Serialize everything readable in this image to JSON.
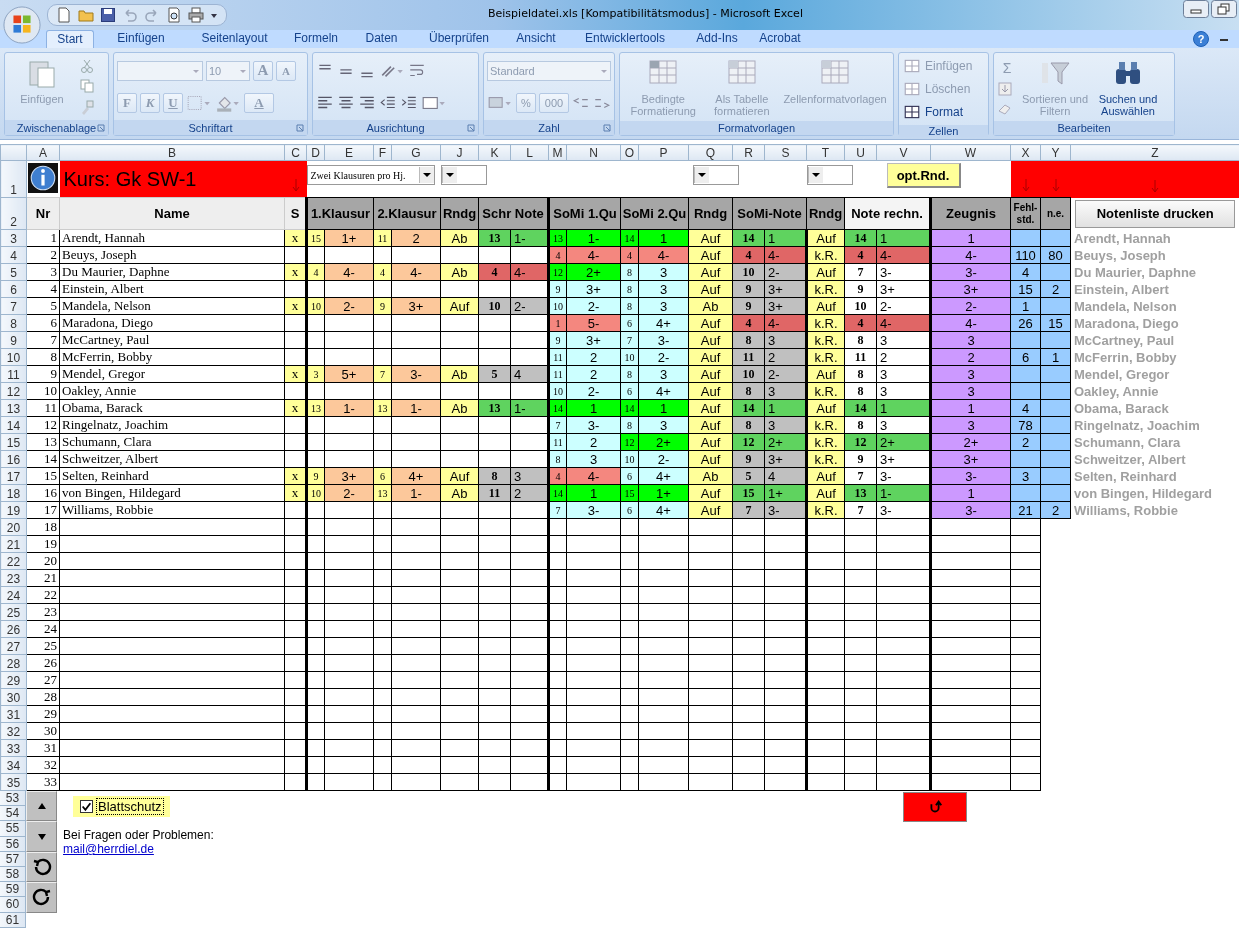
{
  "window": {
    "title": "Beispieldatei.xls  [Kompatibilitätsmodus] - Microsoft Excel"
  },
  "ribbon": {
    "tabs": [
      {
        "label": "Start",
        "selected": true
      },
      {
        "label": "Einfügen",
        "selected": false
      },
      {
        "label": "Seitenlayout",
        "selected": false
      },
      {
        "label": "Formeln",
        "selected": false
      },
      {
        "label": "Daten",
        "selected": false
      },
      {
        "label": "Überprüfen",
        "selected": false
      },
      {
        "label": "Ansicht",
        "selected": false
      },
      {
        "label": "Entwicklertools",
        "selected": false
      },
      {
        "label": "Add-Ins",
        "selected": false
      },
      {
        "label": "Acrobat",
        "selected": false
      }
    ],
    "help": "?",
    "groups": [
      {
        "label": "Zwischenablage",
        "buttons": [
          {
            "label": "Einfügen",
            "disabled": true
          }
        ]
      },
      {
        "label": "Schriftart",
        "font_size": "10",
        "buttons": [
          {
            "label": "A",
            "disabled": true
          },
          {
            "label": "A",
            "disabled": true
          },
          {
            "label": "F",
            "disabled": true
          },
          {
            "label": "K",
            "disabled": true
          },
          {
            "label": "U",
            "disabled": true
          },
          {
            "label": "A",
            "disabled": true
          }
        ]
      },
      {
        "label": "Ausrichtung"
      },
      {
        "label": "Zahl",
        "format": "Standard",
        "buttons": [
          {
            "label": "%",
            "disabled": true
          },
          {
            "label": "000",
            "disabled": true
          }
        ]
      },
      {
        "label": "Formatvorlagen",
        "buttons": [
          {
            "label": "Bedingte Formatierung",
            "disabled": true
          },
          {
            "label": "Als Tabelle formatieren",
            "disabled": true
          },
          {
            "label": "Zellenformatvorlagen",
            "disabled": true
          }
        ]
      },
      {
        "label": "Zellen",
        "buttons": [
          {
            "label": "Einfügen",
            "disabled": true
          },
          {
            "label": "Löschen",
            "disabled": true
          },
          {
            "label": "Format",
            "disabled": false
          }
        ]
      },
      {
        "label": "Bearbeiten",
        "buttons": [
          {
            "label": "Σ",
            "disabled": true
          },
          {
            "label": "Sortieren und Filtern",
            "disabled": true
          },
          {
            "label": "Suchen und Auswählen",
            "disabled": false
          }
        ]
      }
    ]
  },
  "sheet": {
    "columns": [
      "A",
      "B",
      "C",
      "D",
      "E",
      "F",
      "G",
      "J",
      "K",
      "L",
      "M",
      "N",
      "O",
      "P",
      "Q",
      "R",
      "S",
      "T",
      "U",
      "V",
      "W",
      "X",
      "Y",
      "Z"
    ],
    "course": "Kurs:  Gk SW-1",
    "mode": "Zwei Klausuren pro Hj.",
    "opt_button": "opt.Rnd.",
    "headers": [
      "Nr",
      "Name",
      "S",
      "1.Klausur",
      "2.Klausur",
      "Rndg",
      "Schr Note",
      "SoMi 1.Qu",
      "SoMi 2.Qu",
      "Rndg",
      "SoMi-Note",
      "Rndg",
      "Note rechn.",
      "Zeugnis",
      "Fehl-std.",
      "n.e."
    ],
    "print_button": "Notenliste drucken",
    "students": [
      {
        "row": "3",
        "nr": "1",
        "name": "Arendt, Hannah",
        "s": "x",
        "k1": {
          "pts": "15",
          "grade": "1+"
        },
        "k2": {
          "pts": "11",
          "grade": "2"
        },
        "r1": "Ab",
        "schr": {
          "pts": "13",
          "grade": "1-",
          "color": "#5fd35f"
        },
        "so1": {
          "pts": "13",
          "grade": "1-",
          "color": "#00ff00"
        },
        "so2": {
          "pts": "14",
          "grade": "1",
          "color": "#00ff00"
        },
        "r2": "Auf",
        "son": {
          "pts": "14",
          "grade": "1",
          "color": "#5fd35f"
        },
        "r3": "Auf",
        "rech": {
          "pts": "14",
          "grade": "1",
          "color": "#5fd35f"
        },
        "zeugnis": "1",
        "list": "Arendt, Hannah"
      },
      {
        "row": "4",
        "nr": "2",
        "name": "Beuys, Joseph",
        "so1": {
          "pts": "4",
          "grade": "4-",
          "color": "#f4877f"
        },
        "so2": {
          "pts": "4",
          "grade": "4-",
          "color": "#f4877f"
        },
        "r2": "Auf",
        "son": {
          "pts": "4",
          "grade": "4-",
          "color": "#e06666"
        },
        "r3": "k.R.",
        "rech": {
          "pts": "4",
          "grade": "4-",
          "color": "#e06666"
        },
        "zeugnis": "4-",
        "fehl": "110",
        "ne": "80",
        "list": "Beuys, Joseph"
      },
      {
        "row": "5",
        "nr": "3",
        "name": "Du Maurier, Daphne",
        "s": "x",
        "k1": {
          "pts": "4",
          "grade": "4-"
        },
        "k2": {
          "pts": "4",
          "grade": "4-"
        },
        "r1": "Ab",
        "schr": {
          "pts": "4",
          "grade": "4-",
          "color": "#e06666"
        },
        "so1": {
          "pts": "12",
          "grade": "2+",
          "color": "#00ff00"
        },
        "so2": {
          "pts": "8",
          "grade": "3",
          "color": "#ccffff"
        },
        "r2": "Auf",
        "son": {
          "pts": "10",
          "grade": "2-",
          "color": "#c0c0c0"
        },
        "r3": "Auf",
        "rech": {
          "pts": "7",
          "grade": "3-",
          "color": "#ffffff"
        },
        "zeugnis": "3-",
        "fehl": "4",
        "list": "Du Maurier, Daphne"
      },
      {
        "row": "6",
        "nr": "4",
        "name": "Einstein, Albert",
        "so1": {
          "pts": "9",
          "grade": "3+",
          "color": "#ccffff"
        },
        "so2": {
          "pts": "8",
          "grade": "3",
          "color": "#ccffff"
        },
        "r2": "Auf",
        "son": {
          "pts": "9",
          "grade": "3+",
          "color": "#c0c0c0"
        },
        "r3": "k.R.",
        "rech": {
          "pts": "9",
          "grade": "3+",
          "color": "#ffffff"
        },
        "zeugnis": "3+",
        "fehl": "15",
        "ne": "2",
        "list": "Einstein, Albert"
      },
      {
        "row": "7",
        "nr": "5",
        "name": "Mandela, Nelson",
        "s": "x",
        "k1": {
          "pts": "10",
          "grade": "2-"
        },
        "k2": {
          "pts": "9",
          "grade": "3+"
        },
        "r1": "Auf",
        "schr": {
          "pts": "10",
          "grade": "2-",
          "color": "#c0c0c0"
        },
        "so1": {
          "pts": "10",
          "grade": "2-",
          "color": "#ccffff"
        },
        "so2": {
          "pts": "8",
          "grade": "3",
          "color": "#ccffff"
        },
        "r2": "Ab",
        "son": {
          "pts": "9",
          "grade": "3+",
          "color": "#c0c0c0"
        },
        "r3": "Auf",
        "rech": {
          "pts": "10",
          "grade": "2-",
          "color": "#ffffff"
        },
        "zeugnis": "2-",
        "fehl": "1",
        "list": "Mandela, Nelson"
      },
      {
        "row": "8",
        "nr": "6",
        "name": "Maradona, Diego",
        "so1": {
          "pts": "1",
          "grade": "5-",
          "color": "#f4877f"
        },
        "so2": {
          "pts": "6",
          "grade": "4+",
          "color": "#ccffff"
        },
        "r2": "Auf",
        "son": {
          "pts": "4",
          "grade": "4-",
          "color": "#e06666"
        },
        "r3": "k.R.",
        "rech": {
          "pts": "4",
          "grade": "4-",
          "color": "#e06666"
        },
        "zeugnis": "4-",
        "fehl": "26",
        "ne": "15",
        "list": "Maradona, Diego"
      },
      {
        "row": "9",
        "nr": "7",
        "name": "McCartney, Paul",
        "so1": {
          "pts": "9",
          "grade": "3+",
          "color": "#ccffff"
        },
        "so2": {
          "pts": "7",
          "grade": "3-",
          "color": "#ccffff"
        },
        "r2": "Auf",
        "son": {
          "pts": "8",
          "grade": "3",
          "color": "#c0c0c0"
        },
        "r3": "k.R.",
        "rech": {
          "pts": "8",
          "grade": "3",
          "color": "#ffffff"
        },
        "zeugnis": "3",
        "list": "McCartney, Paul"
      },
      {
        "row": "10",
        "nr": "8",
        "name": "McFerrin, Bobby",
        "so1": {
          "pts": "11",
          "grade": "2",
          "color": "#ccffff"
        },
        "so2": {
          "pts": "10",
          "grade": "2-",
          "color": "#ccffff"
        },
        "r2": "Auf",
        "son": {
          "pts": "11",
          "grade": "2",
          "color": "#c0c0c0"
        },
        "r3": "k.R.",
        "rech": {
          "pts": "11",
          "grade": "2",
          "color": "#ffffff"
        },
        "zeugnis": "2",
        "fehl": "6",
        "ne": "1",
        "list": "McFerrin, Bobby"
      },
      {
        "row": "11",
        "nr": "9",
        "name": "Mendel, Gregor",
        "s": "x",
        "k1": {
          "pts": "3",
          "grade": "5+"
        },
        "k2": {
          "pts": "7",
          "grade": "3-"
        },
        "r1": "Ab",
        "schr": {
          "pts": "5",
          "grade": "4",
          "color": "#c0c0c0"
        },
        "so1": {
          "pts": "11",
          "grade": "2",
          "color": "#ccffff"
        },
        "so2": {
          "pts": "8",
          "grade": "3",
          "color": "#ccffff"
        },
        "r2": "Auf",
        "son": {
          "pts": "10",
          "grade": "2-",
          "color": "#c0c0c0"
        },
        "r3": "Auf",
        "rech": {
          "pts": "8",
          "grade": "3",
          "color": "#ffffff"
        },
        "zeugnis": "3",
        "list": "Mendel, Gregor"
      },
      {
        "row": "12",
        "nr": "10",
        "name": "Oakley, Annie",
        "so1": {
          "pts": "10",
          "grade": "2-",
          "color": "#ccffff"
        },
        "so2": {
          "pts": "6",
          "grade": "4+",
          "color": "#ccffff"
        },
        "r2": "Auf",
        "son": {
          "pts": "8",
          "grade": "3",
          "color": "#c0c0c0"
        },
        "r3": "k.R.",
        "rech": {
          "pts": "8",
          "grade": "3",
          "color": "#ffffff"
        },
        "zeugnis": "3",
        "list": "Oakley, Annie"
      },
      {
        "row": "13",
        "nr": "11",
        "name": "Obama, Barack",
        "s": "x",
        "k1": {
          "pts": "13",
          "grade": "1-"
        },
        "k2": {
          "pts": "13",
          "grade": "1-"
        },
        "r1": "Ab",
        "schr": {
          "pts": "13",
          "grade": "1-",
          "color": "#5fd35f"
        },
        "so1": {
          "pts": "14",
          "grade": "1",
          "color": "#00ff00"
        },
        "so2": {
          "pts": "14",
          "grade": "1",
          "color": "#00ff00"
        },
        "r2": "Auf",
        "son": {
          "pts": "14",
          "grade": "1",
          "color": "#5fd35f"
        },
        "r3": "Auf",
        "rech": {
          "pts": "14",
          "grade": "1",
          "color": "#5fd35f"
        },
        "zeugnis": "1",
        "fehl": "4",
        "list": "Obama, Barack"
      },
      {
        "row": "14",
        "nr": "12",
        "name": "Ringelnatz, Joachim",
        "so1": {
          "pts": "7",
          "grade": "3-",
          "color": "#ccffff"
        },
        "so2": {
          "pts": "8",
          "grade": "3",
          "color": "#ccffff"
        },
        "r2": "Auf",
        "son": {
          "pts": "8",
          "grade": "3",
          "color": "#c0c0c0"
        },
        "r3": "k.R.",
        "rech": {
          "pts": "8",
          "grade": "3",
          "color": "#ffffff"
        },
        "zeugnis": "3",
        "fehl": "78",
        "list": "Ringelnatz, Joachim"
      },
      {
        "row": "15",
        "nr": "13",
        "name": "Schumann, Clara",
        "so1": {
          "pts": "11",
          "grade": "2",
          "color": "#ccffff"
        },
        "so2": {
          "pts": "12",
          "grade": "2+",
          "color": "#00ff00"
        },
        "r2": "Auf",
        "son": {
          "pts": "12",
          "grade": "2+",
          "color": "#5fd35f"
        },
        "r3": "k.R.",
        "rech": {
          "pts": "12",
          "grade": "2+",
          "color": "#5fd35f"
        },
        "zeugnis": "2+",
        "fehl": "2",
        "list": "Schumann, Clara"
      },
      {
        "row": "16",
        "nr": "14",
        "name": "Schweitzer, Albert",
        "so1": {
          "pts": "8",
          "grade": "3",
          "color": "#ccffff"
        },
        "so2": {
          "pts": "10",
          "grade": "2-",
          "color": "#ccffff"
        },
        "r2": "Auf",
        "son": {
          "pts": "9",
          "grade": "3+",
          "color": "#c0c0c0"
        },
        "r3": "k.R.",
        "rech": {
          "pts": "9",
          "grade": "3+",
          "color": "#ffffff"
        },
        "zeugnis": "3+",
        "list": "Schweitzer, Albert"
      },
      {
        "row": "17",
        "nr": "15",
        "name": "Selten, Reinhard",
        "s": "x",
        "k1": {
          "pts": "9",
          "grade": "3+"
        },
        "k2": {
          "pts": "6",
          "grade": "4+"
        },
        "r1": "Auf",
        "schr": {
          "pts": "8",
          "grade": "3",
          "color": "#c0c0c0"
        },
        "so1": {
          "pts": "4",
          "grade": "4-",
          "color": "#f4877f"
        },
        "so2": {
          "pts": "6",
          "grade": "4+",
          "color": "#ccffff"
        },
        "r2": "Ab",
        "son": {
          "pts": "5",
          "grade": "4",
          "color": "#c0c0c0"
        },
        "r3": "Auf",
        "rech": {
          "pts": "7",
          "grade": "3-",
          "color": "#ffffff"
        },
        "zeugnis": "3-",
        "fehl": "3",
        "list": "Selten, Reinhard"
      },
      {
        "row": "18",
        "nr": "16",
        "name": "von Bingen, Hildegard",
        "s": "x",
        "k1": {
          "pts": "10",
          "grade": "2-"
        },
        "k2": {
          "pts": "13",
          "grade": "1-"
        },
        "r1": "Ab",
        "schr": {
          "pts": "11",
          "grade": "2",
          "color": "#c0c0c0"
        },
        "so1": {
          "pts": "14",
          "grade": "1",
          "color": "#00ff00"
        },
        "so2": {
          "pts": "15",
          "grade": "1+",
          "color": "#00ff00"
        },
        "r2": "Auf",
        "son": {
          "pts": "15",
          "grade": "1+",
          "color": "#5fd35f"
        },
        "r3": "Auf",
        "rech": {
          "pts": "13",
          "grade": "1-",
          "color": "#5fd35f"
        },
        "zeugnis": "1",
        "list": "von Bingen, Hildegard"
      },
      {
        "row": "19",
        "nr": "17",
        "name": "Williams, Robbie",
        "so1": {
          "pts": "7",
          "grade": "3-",
          "color": "#ccffff"
        },
        "so2": {
          "pts": "6",
          "grade": "4+",
          "color": "#ccffff"
        },
        "r2": "Auf",
        "son": {
          "pts": "7",
          "grade": "3-",
          "color": "#c0c0c0"
        },
        "r3": "k.R.",
        "rech": {
          "pts": "7",
          "grade": "3-",
          "color": "#ffffff"
        },
        "zeugnis": "3-",
        "fehl": "21",
        "ne": "2",
        "list": "Williams, Robbie"
      }
    ],
    "empty_rows": [
      {
        "row": "20",
        "nr": "18"
      },
      {
        "row": "21",
        "nr": "19"
      },
      {
        "row": "22",
        "nr": "20"
      },
      {
        "row": "23",
        "nr": "21"
      },
      {
        "row": "24",
        "nr": "22"
      },
      {
        "row": "25",
        "nr": "23"
      },
      {
        "row": "26",
        "nr": "24"
      },
      {
        "row": "27",
        "nr": "25"
      },
      {
        "row": "28",
        "nr": "26"
      },
      {
        "row": "29",
        "nr": "27"
      },
      {
        "row": "30",
        "nr": "28"
      },
      {
        "row": "31",
        "nr": "29"
      },
      {
        "row": "32",
        "nr": "30"
      },
      {
        "row": "33",
        "nr": "31"
      },
      {
        "row": "34",
        "nr": "32"
      },
      {
        "row": "35",
        "nr": "33"
      }
    ],
    "header_rows": [
      "1",
      "2"
    ],
    "lower_rows": [
      "53",
      "54",
      "55",
      "56",
      "57",
      "58",
      "59",
      "60",
      "61"
    ],
    "protect": {
      "label": "Blattschutz",
      "checked": true
    },
    "contact": "Bei Fragen oder Problemen:",
    "email": "mail@herrdiel.de"
  }
}
